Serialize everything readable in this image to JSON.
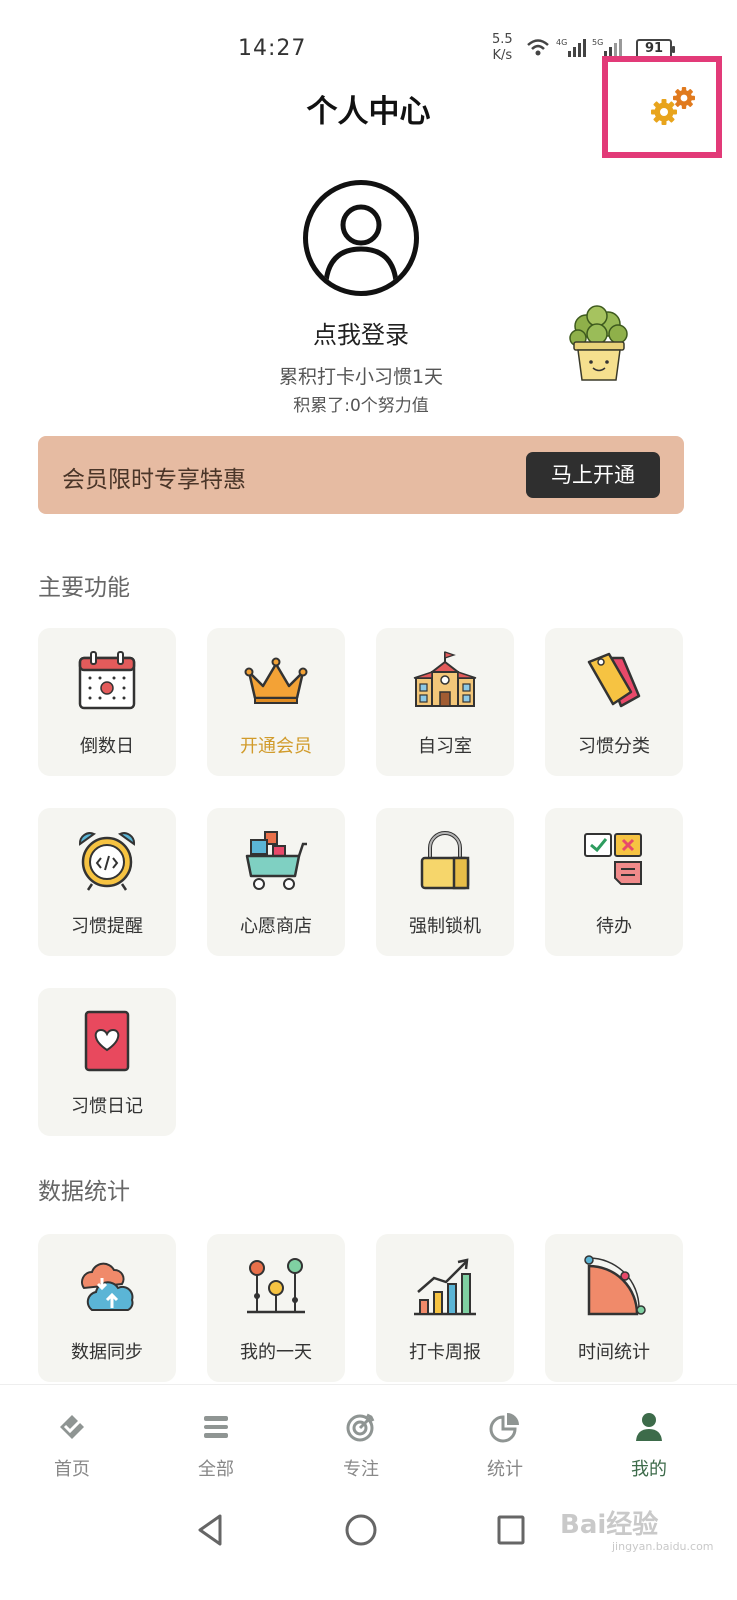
{
  "status_bar": {
    "time": "14:27",
    "net_speed_value": "5.5",
    "net_speed_unit": "K/s",
    "battery": "91",
    "icons": [
      "wifi-icon",
      "signal-4g-icon",
      "signal-5g-icon",
      "battery-icon"
    ]
  },
  "header": {
    "title": "个人中心",
    "settings_icon": "gears-icon",
    "highlight_color": "#e23a78"
  },
  "profile": {
    "avatar_icon": "user-avatar-icon",
    "login_text": "点我登录",
    "checkin_text": "累积打卡小习惯1天",
    "points_text": "积累了:0个努力值",
    "mascot_icon": "cactus-mascot-icon"
  },
  "vip_banner": {
    "text": "会员限时专享特惠",
    "button_label": "马上开通",
    "background_color": "#e6bba2"
  },
  "main_features": {
    "title": "主要功能",
    "items": [
      {
        "label": "倒数日",
        "icon": "calendar-icon"
      },
      {
        "label": "开通会员",
        "icon": "crown-icon"
      },
      {
        "label": "自习室",
        "icon": "school-building-icon"
      },
      {
        "label": "习惯分类",
        "icon": "tags-icon"
      },
      {
        "label": "习惯提醒",
        "icon": "alarm-clock-icon"
      },
      {
        "label": "心愿商店",
        "icon": "shopping-cart-icon"
      },
      {
        "label": "强制锁机",
        "icon": "padlock-icon"
      },
      {
        "label": "待办",
        "icon": "todo-notes-icon"
      },
      {
        "label": "习惯日记",
        "icon": "diary-heart-icon"
      }
    ]
  },
  "data_stats": {
    "title": "数据统计",
    "items": [
      {
        "label": "数据同步",
        "icon": "cloud-sync-icon"
      },
      {
        "label": "我的一天",
        "icon": "timeline-icon"
      },
      {
        "label": "打卡周报",
        "icon": "growth-chart-icon"
      },
      {
        "label": "时间统计",
        "icon": "pie-segment-icon"
      }
    ]
  },
  "bottom_nav": {
    "items": [
      {
        "label": "首页",
        "icon": "home-check-icon"
      },
      {
        "label": "全部",
        "icon": "list-icon"
      },
      {
        "label": "专注",
        "icon": "target-icon"
      },
      {
        "label": "统计",
        "icon": "pie-chart-icon"
      },
      {
        "label": "我的",
        "icon": "person-icon"
      }
    ],
    "active_index": 4,
    "active_color": "#3d6b4a"
  },
  "system_nav": [
    "back-icon",
    "home-icon",
    "recents-icon"
  ],
  "watermark": {
    "text": "Bai经验",
    "sub": "jingyan.baidu.com"
  }
}
